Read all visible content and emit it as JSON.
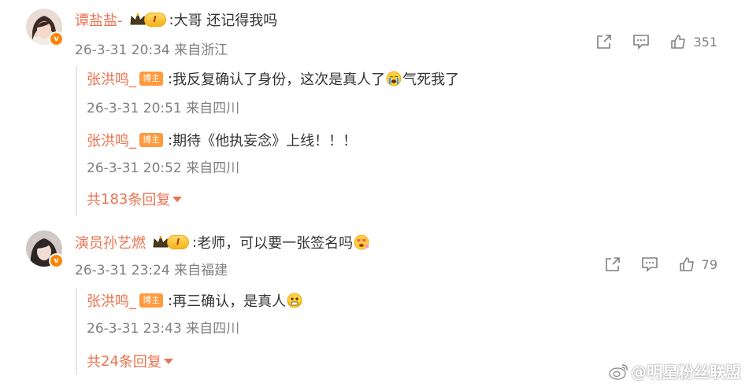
{
  "comments": [
    {
      "username": "谭盐盐-",
      "level_badge": "I",
      "colon": ":",
      "text": "大哥 还记得我吗",
      "meta": "26-3-31 20:34 来自浙江",
      "like_count": "351",
      "replies": [
        {
          "username": "张洪鸣_",
          "role_badge": "博主",
          "colon": ":",
          "text": "我反复确认了身份，这次是真人了",
          "emoji": "crying-emoji",
          "text_after": "气死我了",
          "meta": "26-3-31 20:51 来自四川"
        },
        {
          "username": "张洪鸣_",
          "role_badge": "博主",
          "colon": ":",
          "text": "期待《他执妄念》上线！！！",
          "emoji": "",
          "text_after": "",
          "meta": "26-3-31 20:52 来自四川"
        }
      ],
      "more_replies": {
        "prefix": "共",
        "count": "183",
        "suffix": "条回复"
      }
    },
    {
      "username": "演员孙艺燃",
      "level_badge": "I",
      "colon": ":",
      "text": "老师，可以要一张签名吗",
      "meta": "26-3-31 23:24 来自福建",
      "like_count": "79",
      "replies": [
        {
          "username": "张洪鸣_",
          "role_badge": "博主",
          "colon": ":",
          "text": "再三确认，是真人",
          "emoji": "scared-emoji",
          "text_after": "",
          "meta": "26-3-31 23:43 来自四川"
        }
      ],
      "more_replies": {
        "prefix": "共",
        "count": "24",
        "suffix": "条回复"
      }
    }
  ],
  "watermark": {
    "handle": "@明星粉丝联盟",
    "icon": "weibo-logo"
  },
  "colors": {
    "accent": "#eb7350",
    "meta": "#808080",
    "verified": "#ff8200",
    "badge": "#ff9a3d"
  }
}
